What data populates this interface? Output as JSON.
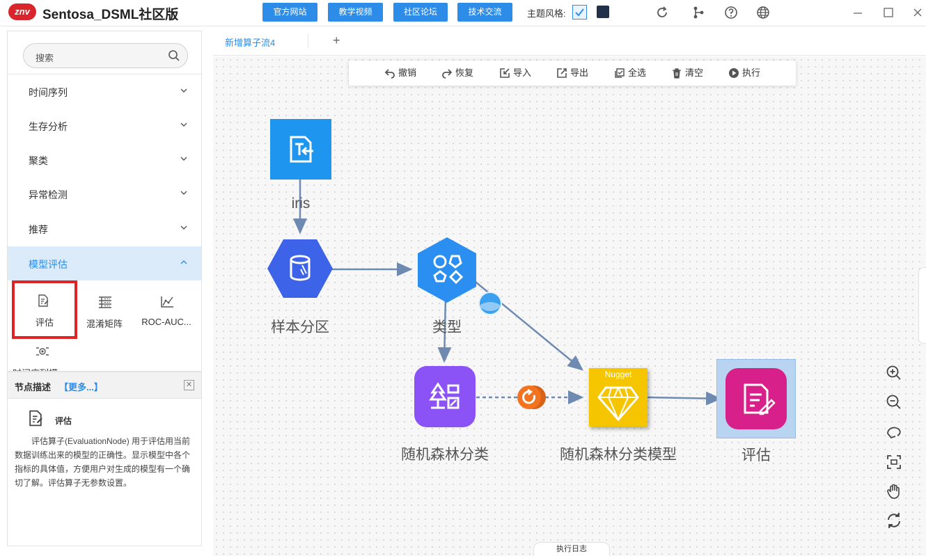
{
  "app": {
    "logo_text": "znv",
    "title": "Sentosa_DSML社区版"
  },
  "header": {
    "buttons": [
      "官方网站",
      "教学视频",
      "社区论坛",
      "技术交流"
    ],
    "theme_label": "主题风格:",
    "icons": [
      "refresh-icon",
      "share-icon",
      "help-icon",
      "globe-icon"
    ],
    "window": [
      "minimize-icon",
      "maximize-icon",
      "close-icon"
    ],
    "accent_color": "#2d8ce8"
  },
  "sidebar": {
    "search_placeholder": "搜索",
    "categories": [
      {
        "label": "时间序列",
        "expanded": false
      },
      {
        "label": "生存分析",
        "expanded": false
      },
      {
        "label": "聚类",
        "expanded": false
      },
      {
        "label": "异常检测",
        "expanded": false
      },
      {
        "label": "推荐",
        "expanded": false
      },
      {
        "label": "模型评估",
        "expanded": true
      }
    ],
    "tools": [
      {
        "label": "评估",
        "icon": "evaluate-icon",
        "selected": true
      },
      {
        "label": "混淆矩阵",
        "icon": "confusion-matrix-icon",
        "selected": false
      },
      {
        "label": "ROC-AUC...",
        "icon": "roc-curve-icon",
        "selected": false
      },
      {
        "label": "时间序列模",
        "icon": "timeseries-model-icon",
        "selected": false
      }
    ]
  },
  "description": {
    "title": "节点描述",
    "more": "【更多...】",
    "node_name": "评估",
    "text": "评估算子(EvaluationNode) 用于评估用当前数据训练出来的模型的正确性。显示模型中各个指标的具体值，方便用户对生成的模型有一个确切了解。评估算子无参数设置。"
  },
  "tabs": {
    "active": "新增算子流4",
    "add": "+"
  },
  "toolbar": {
    "items": [
      {
        "label": "撤销",
        "icon": "undo-icon"
      },
      {
        "label": "恢复",
        "icon": "redo-icon"
      },
      {
        "label": "导入",
        "icon": "import-icon"
      },
      {
        "label": "导出",
        "icon": "export-icon"
      },
      {
        "label": "全选",
        "icon": "select-all-icon"
      },
      {
        "label": "清空",
        "icon": "trash-icon"
      },
      {
        "label": "执行",
        "icon": "play-icon"
      }
    ]
  },
  "flow": {
    "nodes": [
      {
        "id": "iris",
        "label": "iris",
        "shape": "square",
        "color": "#1e96f0"
      },
      {
        "id": "split",
        "label": "样本分区",
        "shape": "hexagon",
        "color": "#3d63e8"
      },
      {
        "id": "type",
        "label": "类型",
        "shape": "hexagon",
        "color": "#2a8ff0"
      },
      {
        "id": "rf",
        "label": "随机森林分类",
        "shape": "rounded",
        "color": "#8b52f5"
      },
      {
        "id": "nugget",
        "label": "随机森林分类模型",
        "shape": "square",
        "color": "#f5c500",
        "badge": "Nugget"
      },
      {
        "id": "eval",
        "label": "评估",
        "shape": "rounded",
        "color": "#d8208a"
      }
    ]
  },
  "zoom_tools": [
    "zoom-in-icon",
    "zoom-out-icon",
    "reset-view-icon",
    "fit-screen-icon",
    "pan-hand-icon",
    "refresh-layout-icon"
  ],
  "log_tab": "执行日志"
}
